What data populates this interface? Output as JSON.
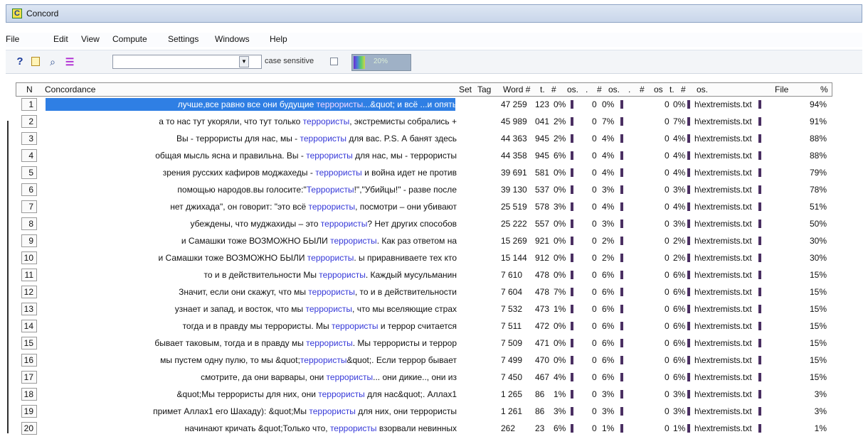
{
  "window": {
    "title": "Concord",
    "app_icon_letter": "C"
  },
  "menu": [
    {
      "label": "File"
    },
    {
      "label": "Edit"
    },
    {
      "label": "View"
    },
    {
      "label": "Compute"
    },
    {
      "label": "Settings"
    },
    {
      "label": "Windows"
    },
    {
      "label": "Help"
    }
  ],
  "toolbar": {
    "search_value": "",
    "case_label": "case sensitive",
    "case_checked": false,
    "progress_text": "20%",
    "progress_value": 0.2
  },
  "table": {
    "headers": {
      "n": "N",
      "concordance": "Concordance",
      "set": "Set",
      "tag": "Tag",
      "word": "Word #",
      "t1": "t.",
      "hash1": "#",
      "os1": "os.",
      "dot2": ".",
      "hash2": "#",
      "os2": "os.",
      "dot3": ".",
      "hash3": "#",
      "os3": "os",
      "t4": "t.",
      "hash4": "#",
      "os4": "os.",
      "file": "File",
      "percent": "%"
    },
    "rows": [
      {
        "n": "1",
        "pre": "лучше,все равно все они будущие ",
        "term": "террористы",
        "post": "...&quot; и всё ...и опять",
        "word": "47 259",
        "t": "123",
        "p1": "0%",
        "col2": "0",
        "p2": "0%",
        "col3": "0",
        "p3": "0%",
        "file": "h\\extremists.txt",
        "percent": "94%",
        "selected": true
      },
      {
        "n": "2",
        "pre": "а то нас тут укоряли, что тут только ",
        "term": "террористы",
        "post": ", экстремисты собрались +",
        "word": "45 989",
        "t": "041",
        "p1": "2%",
        "col2": "0",
        "p2": "7%",
        "col3": "0",
        "p3": "7%",
        "file": "h\\extremists.txt",
        "percent": "91%"
      },
      {
        "n": "3",
        "pre": "Вы - террористы для нас, мы - ",
        "term": "террористы",
        "post": " для вас. P.S. А банят здесь",
        "word": "44 363",
        "t": "945",
        "p1": "2%",
        "col2": "0",
        "p2": "4%",
        "col3": "0",
        "p3": "4%",
        "file": "h\\extremists.txt",
        "percent": "88%"
      },
      {
        "n": "4",
        "pre": "общая мысль ясна и правильна. Вы - ",
        "term": "террористы",
        "post": " для нас, мы - террористы",
        "word": "44 358",
        "t": "945",
        "p1": "6%",
        "col2": "0",
        "p2": "4%",
        "col3": "0",
        "p3": "4%",
        "file": "h\\extremists.txt",
        "percent": "88%"
      },
      {
        "n": "5",
        "pre": "зрения русских кафиров моджахеды - ",
        "term": "террористы",
        "post": " и война идет не против",
        "word": "39 691",
        "t": "581",
        "p1": "0%",
        "col2": "0",
        "p2": "4%",
        "col3": "0",
        "p3": "4%",
        "file": "h\\extremists.txt",
        "percent": "79%"
      },
      {
        "n": "6",
        "pre": "помощью народов.вы голосите:\"",
        "term": "Террористы",
        "post": "!\",\"Убийцы!\" - разве после",
        "word": "39 130",
        "t": "537",
        "p1": "0%",
        "col2": "0",
        "p2": "3%",
        "col3": "0",
        "p3": "3%",
        "file": "h\\extremists.txt",
        "percent": "78%"
      },
      {
        "n": "7",
        "pre": "нет джихада\", он говорит: \"это всё ",
        "term": "террористы",
        "post": ", посмотри – они убивают",
        "word": "25 519",
        "t": "578",
        "p1": "3%",
        "col2": "0",
        "p2": "4%",
        "col3": "0",
        "p3": "4%",
        "file": "h\\extremists.txt",
        "percent": "51%"
      },
      {
        "n": "8",
        "pre": "убеждены, что муджахиды – это ",
        "term": "террористы",
        "post": "? Нет других способов",
        "word": "25 222",
        "t": "557",
        "p1": "0%",
        "col2": "0",
        "p2": "3%",
        "col3": "0",
        "p3": "3%",
        "file": "h\\extremists.txt",
        "percent": "50%"
      },
      {
        "n": "9",
        "pre": "и Самашки тоже ВОЗМОЖНО БЫЛИ ",
        "term": "террористы",
        "post": ". Как раз ответом на",
        "word": "15 269",
        "t": "921",
        "p1": "0%",
        "col2": "0",
        "p2": "2%",
        "col3": "0",
        "p3": "2%",
        "file": "h\\extremists.txt",
        "percent": "30%"
      },
      {
        "n": "10",
        "pre": "и Самашки тоже ВОЗМОЖНО БЫЛИ ",
        "term": "террористы",
        "post": ". ы приравниваете тех кто",
        "word": "15 144",
        "t": "912",
        "p1": "0%",
        "col2": "0",
        "p2": "2%",
        "col3": "0",
        "p3": "2%",
        "file": "h\\extremists.txt",
        "percent": "30%"
      },
      {
        "n": "11",
        "pre": "то и в действительности Мы ",
        "term": "террористы",
        "post": ". Каждый мусульманин",
        "word": "7 610",
        "t": "478",
        "p1": "0%",
        "col2": "0",
        "p2": "6%",
        "col3": "0",
        "p3": "6%",
        "file": "h\\extremists.txt",
        "percent": "15%"
      },
      {
        "n": "12",
        "pre": "Значит, если они скажут, что мы ",
        "term": "террористы",
        "post": ", то и в действительности",
        "word": "7 604",
        "t": "478",
        "p1": "7%",
        "col2": "0",
        "p2": "6%",
        "col3": "0",
        "p3": "6%",
        "file": "h\\extremists.txt",
        "percent": "15%"
      },
      {
        "n": "13",
        "pre": "узнает и запад, и восток, что мы ",
        "term": "террористы",
        "post": ", что мы вселяющие страх",
        "word": "7 532",
        "t": "473",
        "p1": "1%",
        "col2": "0",
        "p2": "6%",
        "col3": "0",
        "p3": "6%",
        "file": "h\\extremists.txt",
        "percent": "15%"
      },
      {
        "n": "14",
        "pre": "тогда и в правду мы террористы. Мы ",
        "term": "террористы",
        "post": " и террор считается",
        "word": "7 511",
        "t": "472",
        "p1": "0%",
        "col2": "0",
        "p2": "6%",
        "col3": "0",
        "p3": "6%",
        "file": "h\\extremists.txt",
        "percent": "15%"
      },
      {
        "n": "15",
        "pre": "бывает таковым, тогда и в правду мы ",
        "term": "террористы",
        "post": ". Мы террористы и террор",
        "word": "7 509",
        "t": "471",
        "p1": "0%",
        "col2": "0",
        "p2": "6%",
        "col3": "0",
        "p3": "6%",
        "file": "h\\extremists.txt",
        "percent": "15%"
      },
      {
        "n": "16",
        "pre": "мы пустем одну пулю, то мы &quot;",
        "term": "террористы",
        "post": "&quot;. Если террор бывает",
        "word": "7 499",
        "t": "470",
        "p1": "0%",
        "col2": "0",
        "p2": "6%",
        "col3": "0",
        "p3": "6%",
        "file": "h\\extremists.txt",
        "percent": "15%"
      },
      {
        "n": "17",
        "pre": "смотрите, да они варвары, они ",
        "term": "террористы",
        "post": "... они дикие.., они из",
        "word": "7 450",
        "t": "467",
        "p1": "4%",
        "col2": "0",
        "p2": "6%",
        "col3": "0",
        "p3": "6%",
        "file": "h\\extremists.txt",
        "percent": "15%"
      },
      {
        "n": "18",
        "pre": "&quot;Мы террористы для них, они ",
        "term": "террористы",
        "post": " для нас&quot;. Аллах1",
        "word": "1 265",
        "t": "86",
        "p1": "1%",
        "col2": "0",
        "p2": "3%",
        "col3": "0",
        "p3": "3%",
        "file": "h\\extremists.txt",
        "percent": "3%"
      },
      {
        "n": "19",
        "pre": "примет Аллах1 его Шахаду): &quot;Мы ",
        "term": "террористы",
        "post": " для них, они террористы",
        "word": "1 261",
        "t": "86",
        "p1": "3%",
        "col2": "0",
        "p2": "3%",
        "col3": "0",
        "p3": "3%",
        "file": "h\\extremists.txt",
        "percent": "3%"
      },
      {
        "n": "20",
        "pre": "начинают кричать &quot;Только что, ",
        "term": "террористы",
        "post": " взорвали невинных",
        "word": "262",
        "t": "23",
        "p1": "6%",
        "col2": "0",
        "p2": "1%",
        "col3": "0",
        "p3": "1%",
        "file": "h\\extremists.txt",
        "percent": "1%"
      }
    ]
  }
}
